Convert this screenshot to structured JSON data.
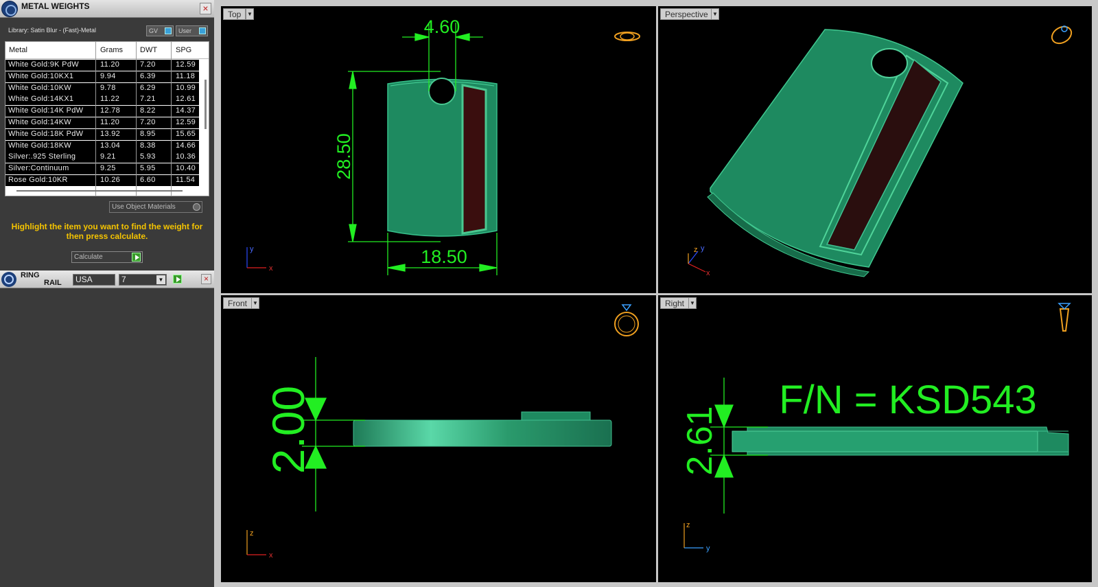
{
  "metal_weights": {
    "title": "METAL WEIGHTS",
    "close": "×",
    "library": "Library: Satin Blur - (Fast)-Metal",
    "gv_label": "GV",
    "user_label": "User",
    "columns": [
      "Metal",
      "Grams",
      "DWT",
      "SPG"
    ],
    "rows": [
      [
        "White Gold:9K PdW",
        "11.20",
        "7.20",
        "12.59"
      ],
      [
        "White Gold:10KX1",
        "9.94",
        "6.39",
        "11.18"
      ],
      [
        "White Gold:10KW",
        "9.78",
        "6.29",
        "10.99"
      ],
      [
        "White Gold:14KX1",
        "11.22",
        "7.21",
        "12.61"
      ],
      [
        "White Gold:14K PdW",
        "12.78",
        "8.22",
        "14.37"
      ],
      [
        "White Gold:14KW",
        "11.20",
        "7.20",
        "12.59"
      ],
      [
        "White Gold:18K PdW",
        "13.92",
        "8.95",
        "15.65"
      ],
      [
        "White Gold:18KW",
        "13.04",
        "8.38",
        "14.66"
      ],
      [
        "Silver:.925 Sterling",
        "9.21",
        "5.93",
        "10.36"
      ],
      [
        "Silver:Continuum",
        "9.25",
        "5.95",
        "10.40"
      ],
      [
        "Rose Gold:10KR",
        "10.26",
        "6.60",
        "11.54"
      ]
    ],
    "use_object_materials": "Use Object Materials",
    "hint": "Highlight the item you want to find the weight for then press calculate.",
    "calculate": "Calculate"
  },
  "ring_rail": {
    "title_line1": "RING",
    "title_line2": "RAIL",
    "standard": "USA",
    "size": "7",
    "close": "×"
  },
  "viewports": {
    "top": {
      "label": "Top",
      "dim_width_top": "4.60",
      "dim_height": "28.50",
      "dim_width_bottom": "18.50",
      "axis_y": "y",
      "axis_x": "x"
    },
    "perspective": {
      "label": "Perspective",
      "axis_z": "z",
      "axis_y": "y",
      "axis_x": "x"
    },
    "front": {
      "label": "Front",
      "dim_thickness": "2.00",
      "axis_z": "z",
      "axis_x": "x"
    },
    "right": {
      "label": "Right",
      "dim_thickness": "2.61",
      "part_number": "F/N = KSD543",
      "axis_z": "z",
      "axis_y": "y"
    }
  },
  "colors": {
    "accent_green": "#22ee22",
    "model_green": "#1e8a60",
    "hint_yellow": "#f5c400"
  }
}
